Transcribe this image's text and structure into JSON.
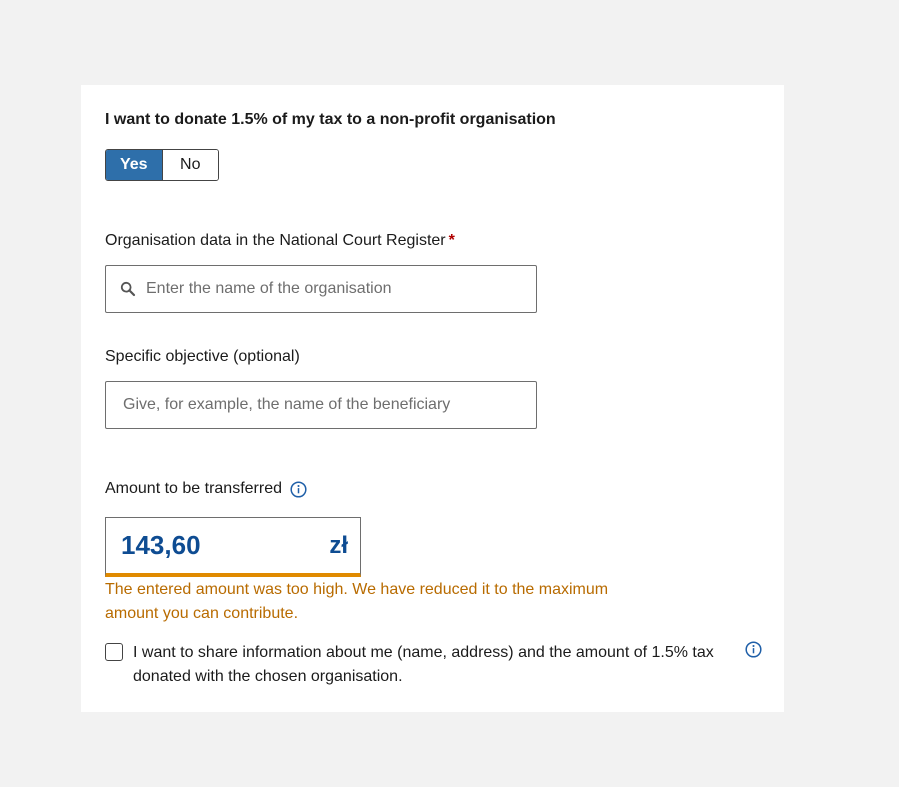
{
  "donation": {
    "question": "I want to donate 1.5% of my tax to a non-profit organisation",
    "options": {
      "yes": "Yes",
      "no": "No"
    },
    "selected": "Yes"
  },
  "organisation": {
    "label": "Organisation data in the National Court Register",
    "required_mark": "*",
    "placeholder": "Enter the name of the organisation",
    "value": ""
  },
  "objective": {
    "label": "Specific objective (optional)",
    "placeholder": "Give, for example, the name of the beneficiary",
    "value": ""
  },
  "amount": {
    "label": "Amount to be transferred",
    "value": "143,60",
    "unit": "zł",
    "warning": "The entered amount was too high. We have reduced it to the maximum amount you can contribute."
  },
  "consent": {
    "text": "I want to share information about me (name, address) and the amount of 1.5% tax donated with the chosen organisation.",
    "checked": false
  },
  "colors": {
    "accent": "#2e6faa",
    "amount_text": "#0e4c92",
    "warning": "#b86b00",
    "warning_underline": "#e08a00",
    "required": "#b00000"
  },
  "icons": [
    "search-icon",
    "info-icon"
  ]
}
